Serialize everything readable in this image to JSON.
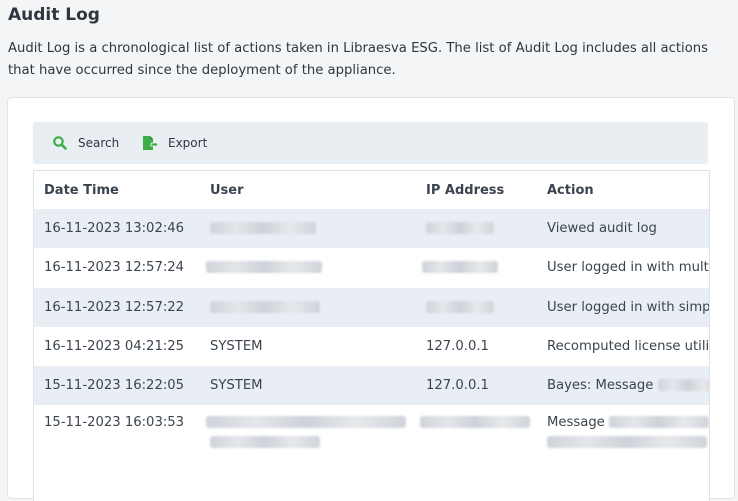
{
  "page": {
    "title": "Audit Log",
    "description": "Audit Log is a chronological list of actions taken in Libraesva ESG. The list of Audit Log includes all actions that have occurred since the deployment of the appliance."
  },
  "toolbar": {
    "search_label": "Search",
    "export_label": "Export",
    "search_icon": "search-icon",
    "export_icon": "export-icon",
    "icon_color": "#3fae49"
  },
  "table": {
    "headers": [
      "Date Time",
      "User",
      "IP Address",
      "Action"
    ],
    "rows": [
      {
        "datetime": "16-11-2023 13:02:46",
        "user": "",
        "ip": "",
        "action": "Viewed audit log"
      },
      {
        "datetime": "16-11-2023 12:57:24",
        "user": "",
        "ip": "",
        "action": "User logged in with multi"
      },
      {
        "datetime": "16-11-2023 12:57:22",
        "user": "",
        "ip": "",
        "action": "User logged in with simp"
      },
      {
        "datetime": "16-11-2023 04:21:25",
        "user": "SYSTEM",
        "ip": "127.0.0.1",
        "action": "Recomputed license utiliz"
      },
      {
        "datetime": "15-11-2023 16:22:05",
        "user": "SYSTEM",
        "ip": "127.0.0.1",
        "action": "Bayes: Message"
      },
      {
        "datetime": "15-11-2023 16:03:53",
        "user": "",
        "ip": "",
        "action": "Message"
      }
    ]
  },
  "colors": {
    "background": "#f4f5f7",
    "row_alt": "#e9eef5",
    "toolbar_bg": "#e9eef3",
    "text": "#2f3640"
  }
}
